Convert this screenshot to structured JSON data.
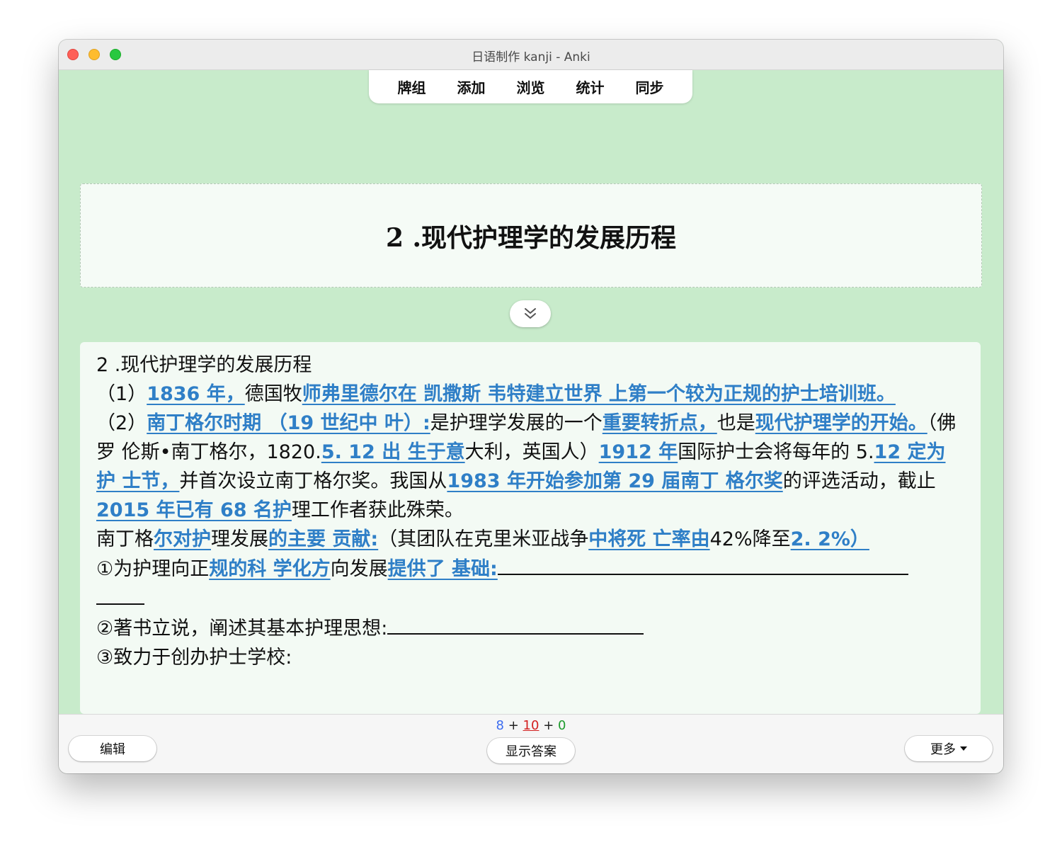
{
  "window": {
    "title": "日语制作 kanji - Anki"
  },
  "toolbar": {
    "tabs": [
      "牌组",
      "添加",
      "浏览",
      "统计",
      "同步"
    ]
  },
  "front": {
    "title": "2 .现代护理学的发展历程"
  },
  "content": {
    "heading": "2 .现代护理学的发展历程",
    "p1": {
      "t1": "（1）",
      "h1": "1836 年，",
      "t2": "德国牧",
      "h2": "师弗里德尔在 凯撒斯 韦特建立世界 上第一个较为正规的护士培训班。"
    },
    "p2": {
      "t1": "（2）",
      "h1": "南丁格尔时期 （19 世纪中 叶）:",
      "t2": "是护理学发展的一个",
      "h2": "重要转折点，",
      "t3": "也是",
      "h3": "现代护理学的开始。",
      "t4": "（佛罗 伦斯•南丁格尔，1820.",
      "h4": "5. 12 出 生于意",
      "t5": "大利，英国人）",
      "h5": "1912 年",
      "t6": "国际护士会将每年的 5.",
      "h6": "12 定为护 士节，",
      "t7": "并首次设立南丁格尔奖。我国从",
      "h7": "1983 年开始参加第 29 届南丁 格尔奖",
      "t8": "的评选活动，截止",
      "h8": "2015 年已有 68 名护",
      "t9": "理工作者获此殊荣。"
    },
    "p3": {
      "t1": "南丁格",
      "h1": "尔对护",
      "t2": "理发展",
      "h2": "的主要 贡献:",
      "t3": "（其团队在克里米亚战争",
      "h3": "中将死 亡率由",
      "t4": "42%降至",
      "h4": "2. 2%）"
    },
    "p4": {
      "t1": "①为护理向正",
      "h1": "规的科 学化方",
      "t2": "向发展",
      "h2": "提供了 基础:"
    },
    "p5": {
      "t1": "②著书立说，阐述其基本护理思想:"
    },
    "p6": {
      "t1": "③致力于创办护士学校:"
    }
  },
  "bottom": {
    "counts": {
      "new": "8",
      "learn": "10",
      "review": "0",
      "plus": "+"
    },
    "edit_label": "编辑",
    "show_answer_label": "显示答案",
    "more_label": "更多"
  }
}
